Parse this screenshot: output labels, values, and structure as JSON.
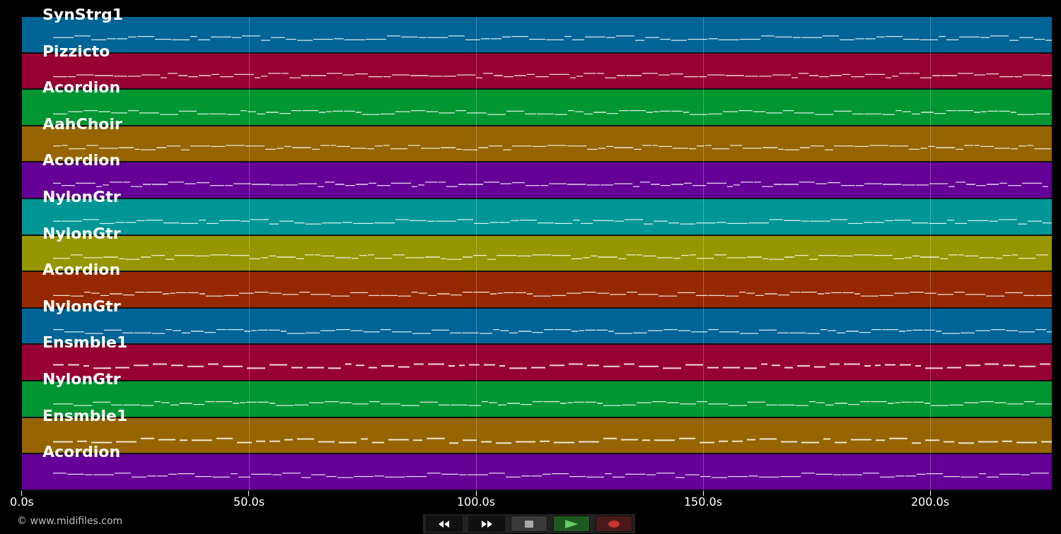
{
  "tracks": [
    {
      "name": "SynStrg1",
      "color": "#006496"
    },
    {
      "name": "Pizzicto",
      "color": "#960032"
    },
    {
      "name": "Acordion",
      "color": "#009632"
    },
    {
      "name": "AahChoir",
      "color": "#966400"
    },
    {
      "name": "Acordion",
      "color": "#640096"
    },
    {
      "name": "NylonGtr",
      "color": "#009696"
    },
    {
      "name": "NylonGtr",
      "color": "#969600"
    },
    {
      "name": "Acordion",
      "color": "#962800"
    },
    {
      "name": "NylonGtr",
      "color": "#006496"
    },
    {
      "name": "Ensmble1",
      "color": "#960032"
    },
    {
      "name": "NylonGtr",
      "color": "#009632"
    },
    {
      "name": "Ensmble1",
      "color": "#966400"
    },
    {
      "name": "Acordion",
      "color": "#640096"
    }
  ],
  "time_axis": {
    "ticks": [
      "0.0s",
      "50.0s",
      "100.0s",
      "150.0s",
      "200.0s"
    ]
  },
  "controls": [
    {
      "kind": "rewind"
    },
    {
      "kind": "forward"
    },
    {
      "kind": "stop"
    },
    {
      "kind": "play"
    },
    {
      "kind": "record"
    }
  ],
  "copyright": "© www.midifiles.com"
}
